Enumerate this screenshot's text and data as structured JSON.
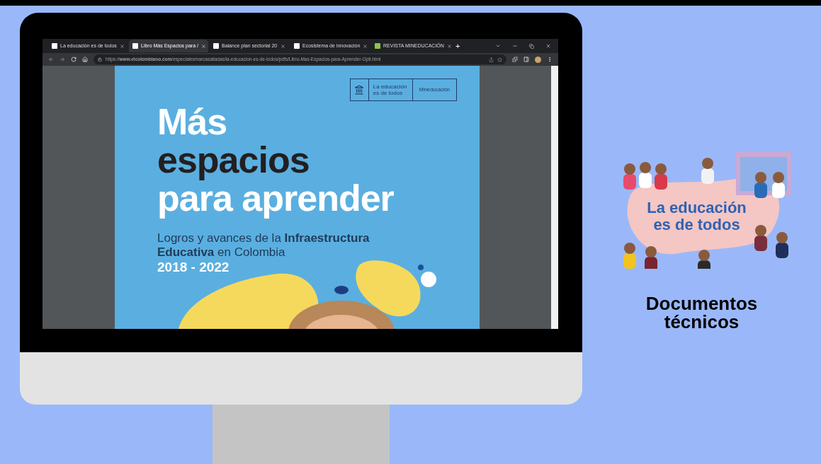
{
  "browser": {
    "tabs": [
      {
        "title": "La educación es de todos",
        "selected": false,
        "color": "#ffffff"
      },
      {
        "title": "Libro Más Espacios para /",
        "selected": true,
        "color": "#ffffff"
      },
      {
        "title": "Balance plan sectorial 20",
        "selected": false,
        "color": "#ffffff"
      },
      {
        "title": "Ecosistema de innovación",
        "selected": false,
        "color": "#ffffff"
      },
      {
        "title": "REVISTA MINEDUCACIÓN",
        "selected": false,
        "color": "#8bc34a"
      }
    ],
    "new_tab": "+",
    "address": "https://**www.elcolombiano.com**/especialesmarcasaliadas/la-educacion-es-de-todos/pdfs/Libro-Mas-Espacios-para-Aprender-Opti.html"
  },
  "document": {
    "logo_text": "La educación es de todos",
    "logo_brand": "Mineducación",
    "title_lines": [
      {
        "text": "Más",
        "kind": "light"
      },
      {
        "text": "espacios",
        "kind": "dark"
      },
      {
        "text": "para aprender",
        "kind": "light"
      }
    ],
    "subtitle": "Logros y avances de la **Infraestructura Educativa** en Colombia",
    "years": "2018 - 2022"
  },
  "side": {
    "banner_text": "La educación es de todos",
    "caption": "Documentos técnicos"
  }
}
